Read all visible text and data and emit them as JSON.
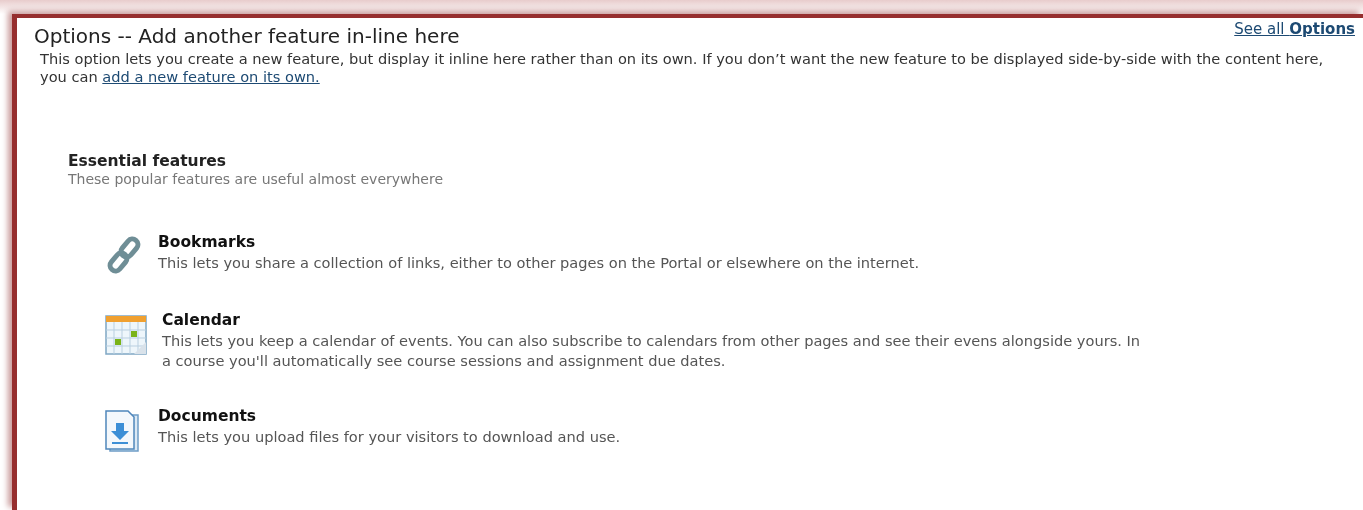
{
  "panel": {
    "title": "Options -- Add another feature in-line here",
    "see_all_link": "See all **Options**"
  },
  "intro": {
    "text": "This option lets you create a new feature, but display it inline here rather than on its own. If you don’t want the new feature to be displayed side-by-side with the content here, you can",
    "link": "add a new feature on its own."
  },
  "section": {
    "title": "Essential features",
    "subtitle": "These popular features are useful almost everywhere"
  },
  "features": [
    {
      "kind": "link",
      "name": "Bookmarks",
      "description": "This lets you share a collection of links, either to other pages on the Portal or elsewhere on the internet."
    },
    {
      "kind": "calendar",
      "name": "Calendar",
      "description": "This lets you keep a calendar of events. You can also subscribe to calendars from other pages and see their evens alongside yours. In a course you'll automatically see course sessions and assignment due dates."
    },
    {
      "kind": "documents",
      "name": "Documents",
      "description": "This lets you upload files for your visitors to download and use."
    }
  ]
}
